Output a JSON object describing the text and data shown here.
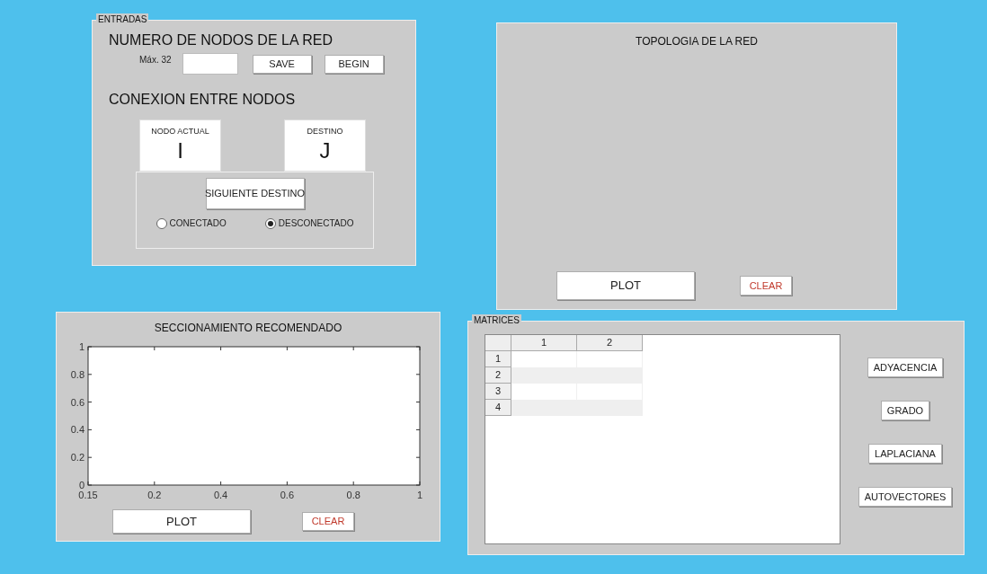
{
  "entradas": {
    "legend": "ENTRADAS",
    "nodes_heading": "NUMERO DE NODOS DE LA RED",
    "max_label": "Máx. 32",
    "buttons": [
      "SAVE",
      "BEGIN"
    ],
    "connection_heading": "CONEXION ENTRE NODOS",
    "displays": [
      {
        "label": "NODO ACTUAL",
        "value": "I"
      },
      {
        "label": "DESTINO",
        "value": "J"
      }
    ],
    "next_button": "SIGUIENTE DESTINO",
    "radios": [
      {
        "label": "CONECTADO",
        "selected": false
      },
      {
        "label": "DESCONECTADO",
        "selected": true
      }
    ]
  },
  "topologia": {
    "title": "TOPOLOGIA DE LA RED",
    "plot_button": "PLOT",
    "clear_button": "CLEAR"
  },
  "seccionamiento": {
    "title": "SECCIONAMIENTO RECOMENDADO",
    "axes": {
      "x_tick_labels": [
        "0.15",
        "0.2",
        "0.4",
        "0.6",
        "0.8",
        "1"
      ],
      "y_tick_labels": [
        "1",
        "0.8",
        "0.6",
        "0.4",
        "0.2",
        "0"
      ]
    },
    "plot_button": "PLOT",
    "clear_button": "CLEAR"
  },
  "matrices": {
    "legend": "MATRICES",
    "table": {
      "columns": [
        "1",
        "2"
      ],
      "rows": [
        {
          "label": "1"
        },
        {
          "label": "2"
        },
        {
          "label": "3"
        },
        {
          "label": "4"
        }
      ]
    },
    "buttons": [
      "ADYACENCIA",
      "GRADO",
      "LAPLACIANA",
      "AUTOVECTORES"
    ]
  }
}
